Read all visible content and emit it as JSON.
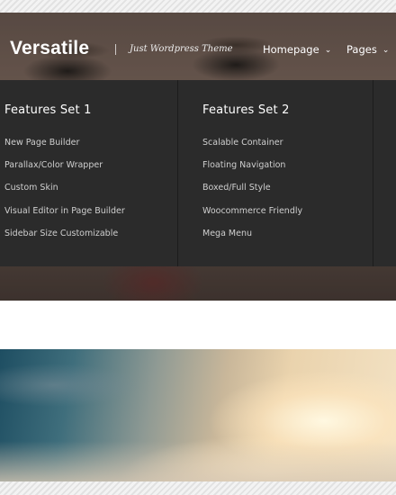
{
  "header": {
    "logo": "Versatile",
    "tagline": "Just Wordpress Theme"
  },
  "nav": {
    "items": [
      {
        "label": "Homepage",
        "caret": "⌄"
      },
      {
        "label": "Pages",
        "caret": "⌄"
      }
    ]
  },
  "mega_menu": {
    "columns": [
      {
        "title": "Features Set 1",
        "items": [
          "New Page Builder",
          "Parallax/Color Wrapper",
          "Custom Skin",
          "Visual Editor in Page Builder",
          "Sidebar Size Customizable"
        ]
      },
      {
        "title": "Features Set 2",
        "items": [
          "Scalable Container",
          "Floating Navigation",
          "Boxed/Full Style",
          "Woocommerce Friendly",
          "Mega Menu"
        ]
      }
    ]
  }
}
